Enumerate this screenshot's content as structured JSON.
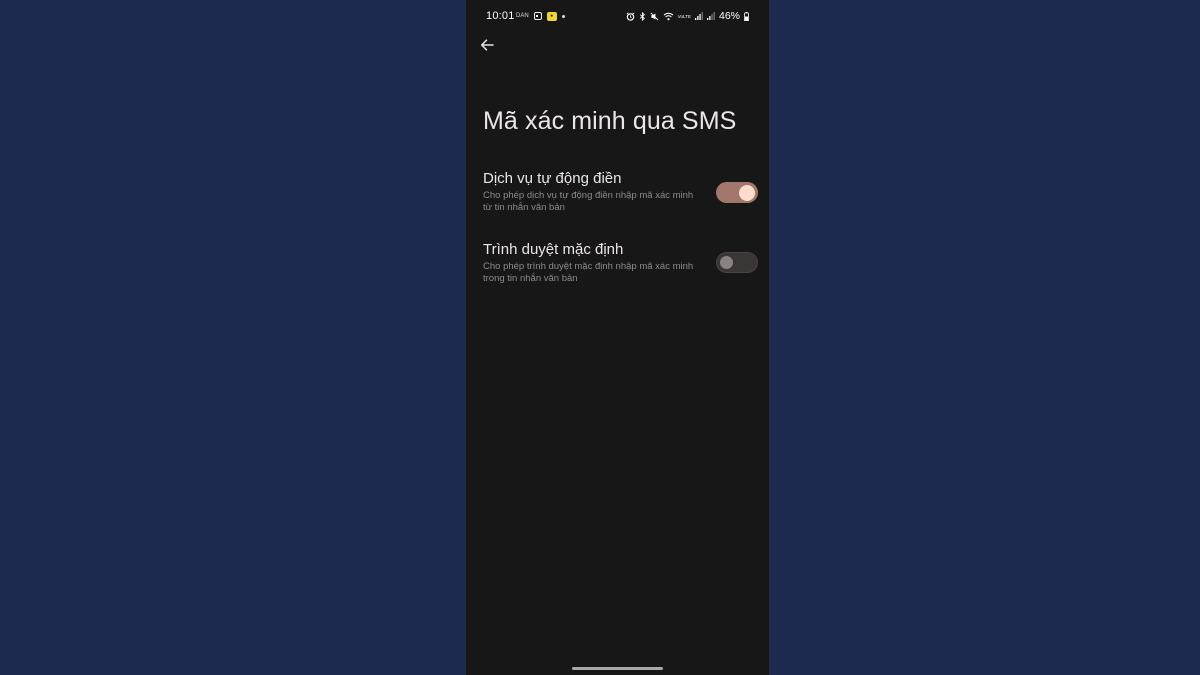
{
  "status_bar": {
    "time": "10:01",
    "icon_label": "DAN",
    "battery": "46%",
    "wifi_label": "VoLTE"
  },
  "page": {
    "title": "Mã xác minh qua SMS"
  },
  "settings": [
    {
      "title": "Dịch vụ tự động điền",
      "description": "Cho phép dịch vụ tự động điền nhập mã xác minh từ tin nhắn văn bản",
      "enabled": true
    },
    {
      "title": "Trình duyệt mặc định",
      "description": "Cho phép trình duyệt mặc định nhập mã xác minh trong tin nhắn văn bản",
      "enabled": false
    }
  ],
  "colors": {
    "background": "#1c2a4e",
    "screen": "#171717",
    "toggle_on_track": "#a2766a",
    "toggle_on_knob": "#fbdccd",
    "toggle_off_track": "#3a3636"
  }
}
